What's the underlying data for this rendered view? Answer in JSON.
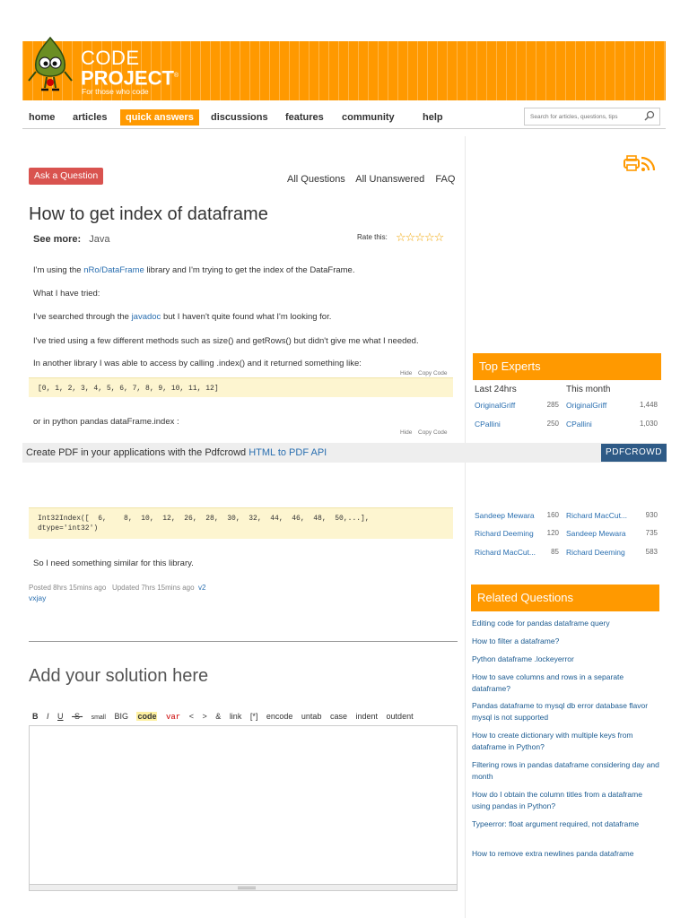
{
  "header": {
    "logo_line1": "CODE",
    "logo_line2": "PROJECT",
    "logo_reg": "®",
    "tagline": "For those who code",
    "brand_color": "#ff9900"
  },
  "nav": {
    "items": [
      "home",
      "articles",
      "quick answers",
      "discussions",
      "features",
      "community",
      "help"
    ],
    "active": "quick answers",
    "search_placeholder": "Search for articles, questions, tips"
  },
  "question_bar": {
    "ask_button": "Ask a Question",
    "links": [
      "All Questions",
      "All Unanswered",
      "FAQ"
    ]
  },
  "question": {
    "title": "How to get index of dataframe",
    "see_more_label": "See more:",
    "tag": "Java",
    "rate_label": "Rate this:",
    "stars": "☆☆☆☆☆",
    "p1_before": "I'm using the ",
    "p1_link": "nRo/DataFrame",
    "p1_after": " library and I'm trying to get the index of the DataFrame.",
    "p2": "What I have tried:",
    "p3_before": "I've searched through the ",
    "p3_link": "javadoc",
    "p3_after": " but I haven't quite found what I'm looking for.",
    "p4": "I've tried using a few different methods such as size() and getRows() but didn't give me what I needed.",
    "p5": "In another library I was able to access by calling .index() and it returned something like:",
    "code1_hide": "Hide",
    "code1_copy": "Copy Code",
    "code1": "[0, 1, 2, 3, 4, 5, 6, 7, 8, 9, 10, 11, 12]",
    "p6": "or in python pandas dataFrame.index :",
    "code2_hide": "Hide",
    "code2_copy": "Copy Code",
    "code2": "Int32Index([  6,    8,  10,  12,  26,  28,  30,  32,  44,  46,  48,  50,...],\ndtype='int32')",
    "p7": "So I need something similar for this library.",
    "posted": "Posted 8hrs 15mins ago",
    "updated": "Updated 7hrs 15mins ago",
    "version": "v2",
    "author": "vxjay"
  },
  "pdf_bar": {
    "text": "Create PDF in your applications with the Pdfcrowd ",
    "link": "HTML to PDF API",
    "button": "PDFCROWD"
  },
  "solution": {
    "heading": "Add your solution here",
    "toolbar": [
      "B",
      "I",
      "U",
      "-S-",
      "small",
      "BIG",
      "code",
      "var",
      "<",
      ">",
      "&",
      "link",
      "[*]",
      "encode",
      "untab",
      "case",
      "indent",
      "outdent"
    ]
  },
  "top_experts": {
    "heading": "Top Experts",
    "col1": "Last 24hrs",
    "col2": "This month",
    "rows": [
      {
        "n1": "OriginalGriff",
        "s1": "285",
        "n2": "OriginalGriff",
        "s2": "1,448"
      },
      {
        "n1": "CPallini",
        "s1": "250",
        "n2": "CPallini",
        "s2": "1,030"
      },
      {
        "n1": "Sandeep Mewara",
        "s1": "160",
        "n2": "Richard MacCut...",
        "s2": "930"
      },
      {
        "n1": "Richard Deeming",
        "s1": "120",
        "n2": "Sandeep Mewara",
        "s2": "735"
      },
      {
        "n1": "Richard MacCut...",
        "s1": "85",
        "n2": "Richard Deeming",
        "s2": "583"
      }
    ]
  },
  "related": {
    "heading": "Related Questions",
    "items": [
      "Editing code for pandas dataframe query",
      "How to filter a dataframe?",
      "Python dataframe .lockeyerror",
      "How to save columns and rows in a separate dataframe?",
      "Pandas dataframe to mysql db error database flavor mysql is not supported",
      "How to create dictionary with multiple keys from dataframe in Python?",
      "Filtering rows in pandas dataframe considering day and month",
      "How do I obtain the column titles from a dataframe using pandas in Python?",
      "Typeerror: float argument required, not dataframe",
      "How to remove extra newlines panda dataframe"
    ]
  }
}
